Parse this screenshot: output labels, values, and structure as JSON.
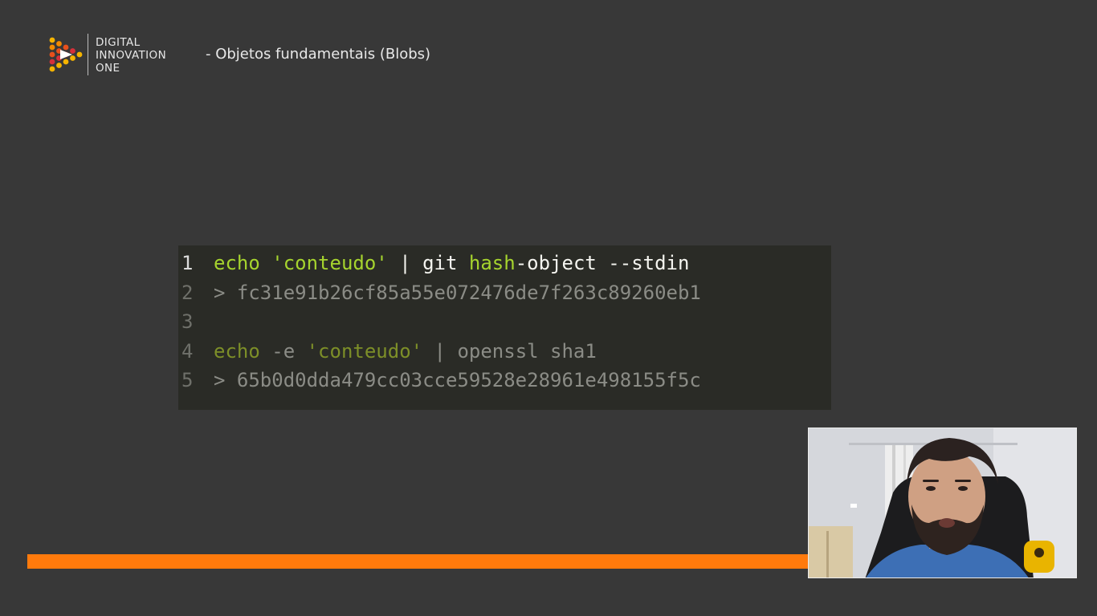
{
  "brand": {
    "logo_lines": [
      "DIGITAL",
      "INNOVATION",
      "ONE"
    ],
    "logo_colors": [
      "#f5b400",
      "#f28a00",
      "#e8501c",
      "#d6303a"
    ],
    "logo_icon": "triangle-dots-logo-icon"
  },
  "slide": {
    "title": "- Objetos fundamentais (Blobs)"
  },
  "code": {
    "lines": [
      {
        "number": "1",
        "tokens": [
          {
            "text": "echo",
            "kind": "kw"
          },
          {
            "text": " ",
            "kind": "txt"
          },
          {
            "text": "'conteudo'",
            "kind": "str"
          },
          {
            "text": " | git ",
            "kind": "txt"
          },
          {
            "text": "hash",
            "kind": "kw"
          },
          {
            "text": "-object --stdin",
            "kind": "txt"
          }
        ]
      },
      {
        "number": "2",
        "tokens": [
          {
            "text": "> fc31e91b26cf85a55e072476de7f263c89260eb1",
            "kind": "out"
          }
        ]
      },
      {
        "number": "3",
        "tokens": []
      },
      {
        "number": "4",
        "tokens": [
          {
            "text": "echo",
            "kind": "dimkw"
          },
          {
            "text": " -e ",
            "kind": "dimtxt"
          },
          {
            "text": "'conteudo'",
            "kind": "dimkw"
          },
          {
            "text": " | openssl sha1",
            "kind": "dimtxt"
          }
        ]
      },
      {
        "number": "5",
        "tokens": [
          {
            "text": "> 65b0d0dda479cc03cce59528e28961e498155f5c",
            "kind": "out"
          }
        ]
      }
    ],
    "colors": {
      "background": "#2a2b26",
      "keyword": "#a6d42e",
      "text": "#f5f5f0",
      "dim": "#8b8c86"
    }
  },
  "progress": {
    "fraction": 1.0,
    "color": "#ff7a0c"
  },
  "webcam": {
    "description_icon": "presenter-video-feed"
  }
}
